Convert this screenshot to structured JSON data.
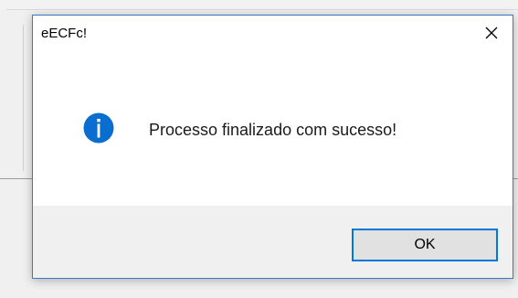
{
  "dialog": {
    "title": "eECFc!",
    "message": "Processo finalizado com sucesso!",
    "ok_label": "OK",
    "icon": "info-icon",
    "close_icon": "close-icon"
  },
  "colors": {
    "accent": "#0078d7",
    "info_icon": "#0a6ed1",
    "dialog_border": "#3c78c8",
    "footer_bg": "#f0f0f0"
  }
}
